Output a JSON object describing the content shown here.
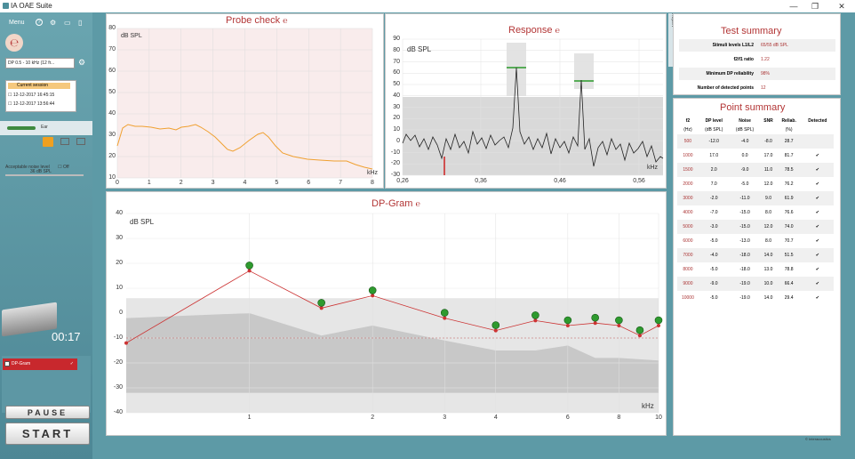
{
  "window": {
    "title": "IA OAE Suite"
  },
  "sidebar": {
    "menu_label": "Menu",
    "protocol_select": "DP 0.5 - 10 kHz (12 fr...",
    "session": {
      "current_label": "Current session",
      "rows": [
        "12-12-2017 16:45:15",
        "12-12-2017 13:56:44"
      ]
    },
    "ear_label": "Ear",
    "acceptable_noise_label": "Acceptable noise level",
    "noise_off_label": "Off",
    "noise_value": "36 dB SPL",
    "timer": "00:17",
    "dpgram_item": "DP-Gram",
    "pause_label": "PAUSE",
    "start_label": "START"
  },
  "probe_check": {
    "title": "Probe check",
    "ylabel": "dB SPL",
    "xunit": "kHz",
    "yticks": [
      "80",
      "70",
      "60",
      "50",
      "40",
      "30",
      "20",
      "10"
    ],
    "xticks": [
      "0",
      "1",
      "2",
      "3",
      "4",
      "5",
      "6",
      "7",
      "8"
    ]
  },
  "response": {
    "title": "Response",
    "ylabel": "dB SPL",
    "xunit": "kHz",
    "yticks": [
      "90",
      "80",
      "70",
      "60",
      "50",
      "40",
      "30",
      "20",
      "10",
      "0",
      "-10",
      "-20",
      "-30"
    ],
    "xticks": [
      "0,26",
      "0,36",
      "0,46",
      "0,56"
    ]
  },
  "dpgram": {
    "title": "DP-Gram",
    "ylabel": "dB SPL",
    "xunit": "kHz",
    "yticks": [
      "40",
      "30",
      "20",
      "10",
      "0",
      "-10",
      "-20",
      "-30",
      "-40"
    ],
    "xticks": [
      "1",
      "2",
      "3",
      "4",
      "6",
      "8",
      "10"
    ]
  },
  "chart_data": [
    {
      "type": "line",
      "title": "DP-Gram",
      "xlabel": "kHz",
      "ylabel": "dB SPL",
      "ylim": [
        -40,
        40
      ],
      "xscale": "log",
      "series": [
        {
          "values_x": [
            1,
            2,
            3,
            4,
            5,
            6,
            7,
            8,
            9,
            10
          ],
          "values": [
            17,
            2,
            7,
            -2,
            -7,
            -3,
            -5,
            -4,
            -5,
            -9
          ]
        }
      ]
    }
  ],
  "test_summary": {
    "title": "Test summary",
    "rows": [
      {
        "label": "Stimuli levels L1/L2",
        "value": "65/55 dB SPL"
      },
      {
        "label": "f2/f1 ratio",
        "value": "1.22"
      },
      {
        "label": "Minimum DP reliability",
        "value": "98%"
      },
      {
        "label": "Number of detected points",
        "value": "12"
      }
    ]
  },
  "point_summary": {
    "title": "Point summary",
    "headers": [
      "f2",
      "DP level",
      "Noise",
      "SNR",
      "Reliab.",
      "Detected"
    ],
    "subheaders": [
      "(Hz)",
      "(dB SPL)",
      "(dB SPL)",
      "",
      "(%)",
      ""
    ],
    "rows": [
      [
        "500",
        "-12.0",
        "-4.0",
        "-8.0",
        "28.7",
        ""
      ],
      [
        "1000",
        "17.0",
        "0.0",
        "17.0",
        "81.7",
        "✔"
      ],
      [
        "1500",
        "2.0",
        "-9.0",
        "11.0",
        "78.5",
        "✔"
      ],
      [
        "2000",
        "7.0",
        "-5.0",
        "12.0",
        "76.2",
        "✔"
      ],
      [
        "3000",
        "-2.0",
        "-11.0",
        "9.0",
        "61.9",
        "✔"
      ],
      [
        "4000",
        "-7.0",
        "-15.0",
        "8.0",
        "76.6",
        "✔"
      ],
      [
        "5000",
        "-3.0",
        "-15.0",
        "12.0",
        "74.0",
        "✔"
      ],
      [
        "6000",
        "-5.0",
        "-13.0",
        "8.0",
        "70.7",
        "✔"
      ],
      [
        "7000",
        "-4.0",
        "-18.0",
        "14.0",
        "51.5",
        "✔"
      ],
      [
        "8000",
        "-5.0",
        "-18.0",
        "13.0",
        "78.8",
        "✔"
      ],
      [
        "9000",
        "-9.0",
        "-19.0",
        "10.0",
        "66.4",
        "✔"
      ],
      [
        "10000",
        "-5.0",
        "-19.0",
        "14.0",
        "29.4",
        "✔"
      ]
    ]
  },
  "footer": {
    "brand": "© Interacoustics",
    "side_tab": "Report"
  }
}
